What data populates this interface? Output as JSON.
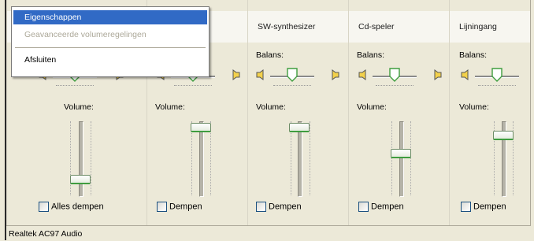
{
  "menu": {
    "items": [
      {
        "label": "Eigenschappen",
        "state": "selected"
      },
      {
        "label": "Geavanceerde volumeregelingen",
        "state": "disabled"
      },
      {
        "label": "Afsluiten",
        "state": "normal"
      }
    ]
  },
  "columns": [
    {
      "header": "",
      "balance_label": "",
      "volume_label": "Volume:",
      "mute_label": "Alles dempen",
      "volume_level": 0.15,
      "balance": 0.5
    },
    {
      "header": "",
      "balance_label": "",
      "volume_label": "Volume:",
      "mute_label": "Dempen",
      "volume_level": 0.92,
      "balance": 0.5
    },
    {
      "header": "SW-synthesizer",
      "balance_label": "Balans:",
      "volume_label": "Volume:",
      "mute_label": "Dempen",
      "volume_level": 0.92,
      "balance": 0.5
    },
    {
      "header": "Cd-speler",
      "balance_label": "Balans:",
      "volume_label": "Volume:",
      "mute_label": "Dempen",
      "volume_level": 0.5,
      "balance": 0.5
    },
    {
      "header": "Lijningang",
      "balance_label": "Balans:",
      "volume_label": "Volume:",
      "mute_label": "Dempen",
      "volume_level": 0.78,
      "balance": 0.5
    }
  ],
  "status_bar": {
    "text": "Realtek AC97 Audio"
  },
  "colors": {
    "menu_highlight": "#316ac5",
    "thumb_accent": "#3f9d3f",
    "window_bg": "#ece9d8"
  }
}
